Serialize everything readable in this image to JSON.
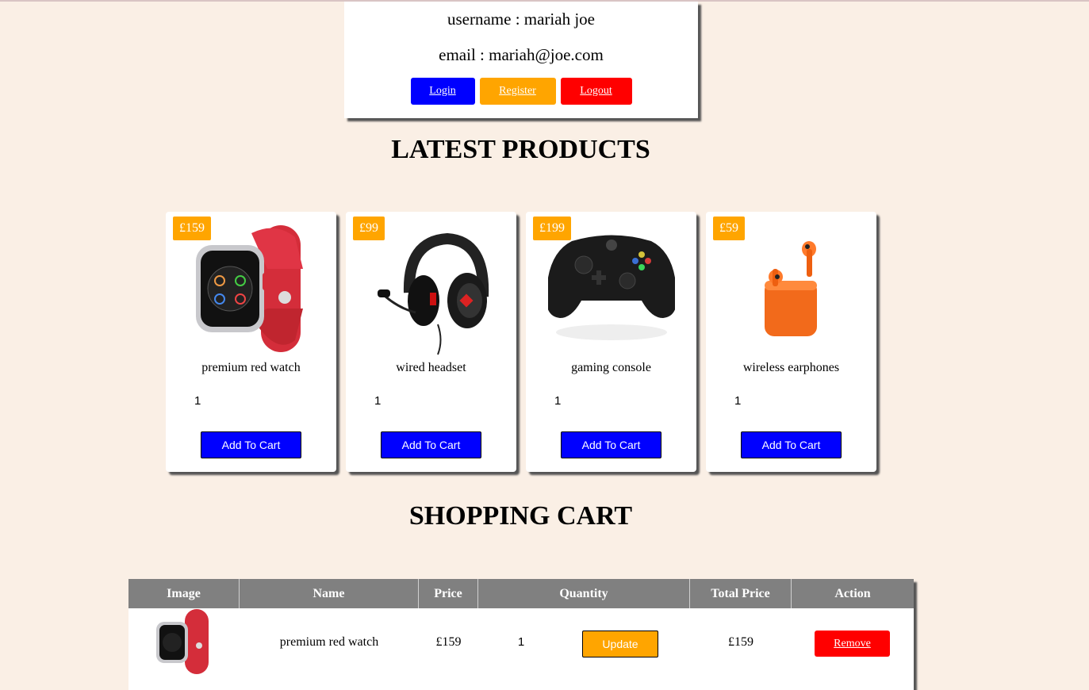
{
  "user": {
    "username_line": "username : mariah joe",
    "email_line": "email : mariah@joe.com",
    "login_label": "Login",
    "register_label": "Register",
    "logout_label": "Logout"
  },
  "latest": {
    "heading": "LATEST PRODUCTS",
    "add_label": "Add To Cart",
    "products": [
      {
        "price": "£159",
        "name": "premium red watch",
        "qty": "1",
        "image": "red-watch"
      },
      {
        "price": "£99",
        "name": "wired headset",
        "qty": "1",
        "image": "headset"
      },
      {
        "price": "£199",
        "name": "gaming console",
        "qty": "1",
        "image": "game-controller"
      },
      {
        "price": "£59",
        "name": "wireless earphones",
        "qty": "1",
        "image": "earphones"
      }
    ]
  },
  "cart": {
    "heading": "SHOPPING CART",
    "columns": [
      "Image",
      "Name",
      "Price",
      "Quantity",
      "Total Price",
      "Action"
    ],
    "rows": [
      {
        "name": "premium red watch",
        "price": "£159",
        "qty": "1",
        "update_label": "Update",
        "total": "£159",
        "remove_label": "Remove"
      }
    ]
  },
  "colors": {
    "background": "#faefe5",
    "blue": "#0000ff",
    "orange": "#ffa500",
    "red": "#ff0000",
    "table_header": "#808080"
  }
}
